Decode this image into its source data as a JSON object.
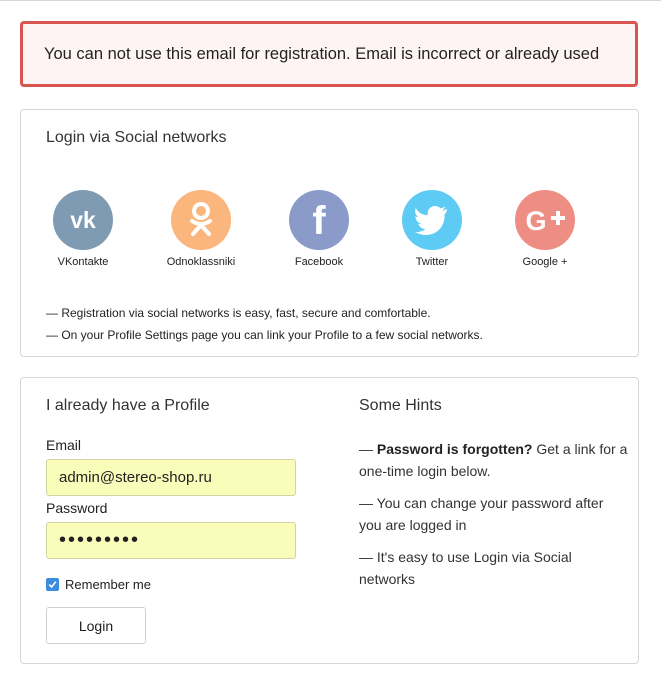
{
  "alert": {
    "message": "You can not use this email for registration. Email is incorrect or already used"
  },
  "social": {
    "title": "Login via Social networks",
    "networks": [
      {
        "label": "VKontakte",
        "icon": "vk-icon",
        "color": "#7f9bb4"
      },
      {
        "label": "Odnoklassniki",
        "icon": "odnoklassniki-icon",
        "color": "#fbb67e"
      },
      {
        "label": "Facebook",
        "icon": "facebook-icon",
        "color": "#8a9bc9"
      },
      {
        "label": "Twitter",
        "icon": "twitter-icon",
        "color": "#5ecbf4"
      },
      {
        "label": "Google +",
        "icon": "google-plus-icon",
        "color": "#ee8d84"
      }
    ],
    "notes": [
      "— Registration via social networks is easy, fast, secure and comfortable.",
      "— On your Profile Settings page you can link your Profile to a few social networks."
    ]
  },
  "login": {
    "title": "I already have a Profile",
    "email_label": "Email",
    "email_value": "admin@stereo-shop.ru",
    "password_label": "Password",
    "password_value": "•••••••••",
    "remember_label": "Remember me",
    "remember_checked": true,
    "button_label": "Login"
  },
  "hints": {
    "title": "Some Hints",
    "hint1_prefix": "— ",
    "hint1_bold": "Password is forgotten?",
    "hint1_rest": " Get a link for a one-time login below.",
    "hint2": "— You can change your password after you are logged in",
    "hint3": "— It's easy to use Login via Social networks"
  },
  "colors": {
    "alert_border": "#d9534f",
    "alert_background": "#fff4f4",
    "input_autofill": "#fafcb9",
    "checkbox_accent": "#3d8ddf"
  }
}
